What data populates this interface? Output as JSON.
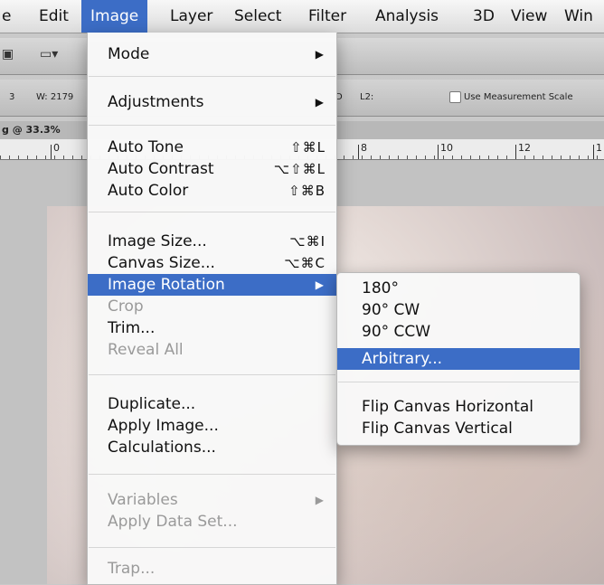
{
  "menubar": {
    "items": [
      "e",
      "Edit",
      "Image",
      "Layer",
      "Select",
      "Filter",
      "Analysis",
      "3D",
      "View",
      "Win"
    ],
    "active": "Image"
  },
  "options_bar": {
    "zoom_field": "3",
    "width_label": "W: 2179",
    "l2_label": "L2:",
    "measurement_checkbox_label": "Use Measurement Scale",
    "d_label": "D"
  },
  "document": {
    "tab_label": "g @ 33.3%"
  },
  "ruler": {
    "labels": [
      "0",
      "8",
      "10",
      "12",
      "1"
    ]
  },
  "image_menu": {
    "items": [
      {
        "label": "Mode",
        "submenu": true
      },
      {
        "label": "Adjustments",
        "submenu": true
      },
      {
        "label": "Auto Tone",
        "shortcut": "⇧⌘L"
      },
      {
        "label": "Auto Contrast",
        "shortcut": "⌥⇧⌘L"
      },
      {
        "label": "Auto Color",
        "shortcut": "⇧⌘B"
      },
      {
        "label": "Image Size...",
        "shortcut": "⌥⌘I"
      },
      {
        "label": "Canvas Size...",
        "shortcut": "⌥⌘C"
      },
      {
        "label": "Image Rotation",
        "submenu": true,
        "highlighted": true
      },
      {
        "label": "Crop",
        "disabled": true
      },
      {
        "label": "Trim..."
      },
      {
        "label": "Reveal All",
        "disabled": true
      },
      {
        "label": "Duplicate..."
      },
      {
        "label": "Apply Image..."
      },
      {
        "label": "Calculations..."
      },
      {
        "label": "Variables",
        "submenu": true,
        "disabled": true
      },
      {
        "label": "Apply Data Set...",
        "disabled": true
      },
      {
        "label": "Trap...",
        "disabled": true
      }
    ]
  },
  "rotation_menu": {
    "items": [
      {
        "label": "180°"
      },
      {
        "label": "90° CW"
      },
      {
        "label": "90° CCW"
      },
      {
        "label": "Arbitrary...",
        "highlighted": true
      },
      {
        "label": "Flip Canvas Horizontal"
      },
      {
        "label": "Flip Canvas Vertical"
      }
    ]
  },
  "colors": {
    "highlight": "#3c6dc6"
  }
}
